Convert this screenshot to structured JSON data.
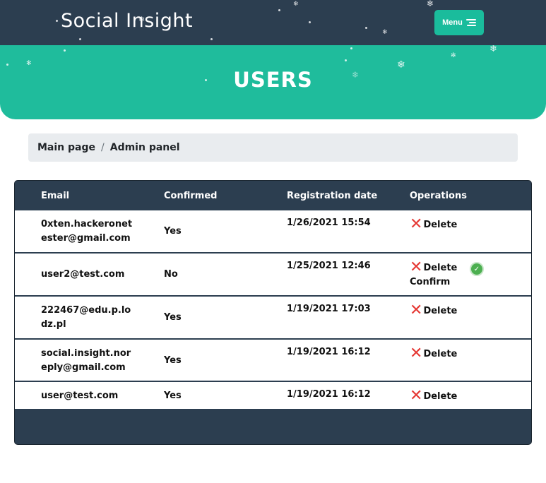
{
  "header": {
    "logo": "Social Insight",
    "menu_label": "Menu"
  },
  "hero": {
    "title": "USERS"
  },
  "breadcrumb": {
    "items": [
      "Main page",
      "Admin panel"
    ],
    "separator": "/"
  },
  "table": {
    "columns": [
      "Email",
      "Confirmed",
      "Registration date",
      "Operations"
    ],
    "rows": [
      {
        "email": "0xten.hackeronetester@gmail.com",
        "confirmed": "Yes",
        "date": "1/26/2021 15:54",
        "delete": "Delete"
      },
      {
        "email": "user2@test.com",
        "confirmed": "No",
        "date": "1/25/2021 12:46",
        "delete": "Delete",
        "confirm": "Confirm"
      },
      {
        "email": "222467@edu.p.lodz.pl",
        "confirmed": "Yes",
        "date": "1/19/2021 17:03",
        "delete": "Delete"
      },
      {
        "email": "social.insight.noreply@gmail.com",
        "confirmed": "Yes",
        "date": "1/19/2021 16:12",
        "delete": "Delete"
      },
      {
        "email": "user@test.com",
        "confirmed": "Yes",
        "date": "1/19/2021 16:12",
        "delete": "Delete"
      }
    ]
  },
  "colors": {
    "navy": "#2c3e50",
    "teal": "#1fbc9c",
    "delete_red": "#e53935",
    "confirm_green": "#4caf50"
  },
  "icons": [
    "menu-icon",
    "delete-x-icon",
    "confirm-check-icon",
    "snowflake-icon"
  ]
}
